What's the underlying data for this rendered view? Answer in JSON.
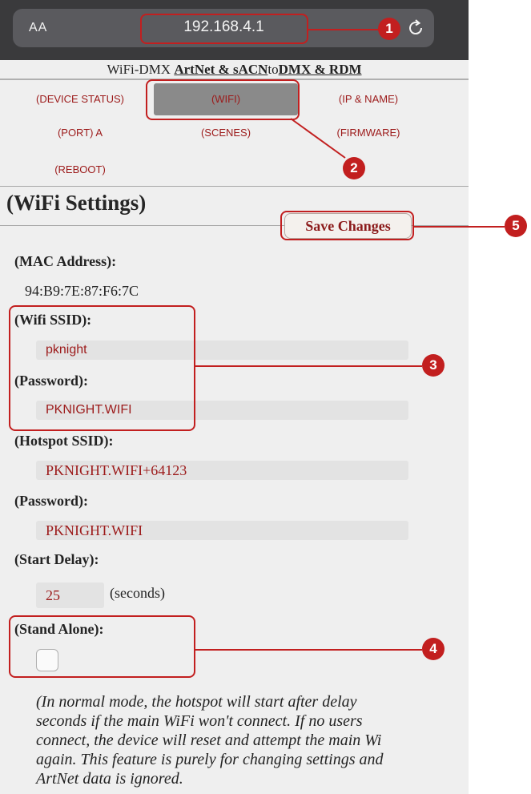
{
  "browser": {
    "text_size_label": "AA",
    "url": "192.168.4.1",
    "reload_icon": "reload-icon"
  },
  "header": {
    "prefix": "WiFi-DMX ",
    "artnet": "ArtNet & sACN",
    "to": "to",
    "dmx": "DMX & RDM"
  },
  "nav": {
    "device_status": "(DEVICE STATUS)",
    "wifi": "(WIFI)",
    "ip_name": "(IP & NAME)",
    "port_a": "(PORT) A",
    "scenes": "(SCENES)",
    "firmware": "(FIRMWARE)",
    "reboot": "(REBOOT)"
  },
  "page": {
    "title": "(WiFi Settings)",
    "save_label": "Save Changes"
  },
  "fields": {
    "mac_label": "(MAC Address):",
    "mac_value": "94:B9:7E:87:F6:7C",
    "wifi_ssid_label": "(Wifi SSID):",
    "wifi_ssid_value": "pknight",
    "wifi_password_label": "(Password):",
    "wifi_password_value": "PKNIGHT.WIFI",
    "hotspot_ssid_label": "(Hotspot SSID):",
    "hotspot_ssid_value": "PKNIGHT.WIFI+64123",
    "hotspot_password_label": "(Password):",
    "hotspot_password_value": "PKNIGHT.WIFI",
    "start_delay_label": "(Start Delay):",
    "start_delay_value": "25",
    "start_delay_unit": "(seconds)",
    "stand_alone_label": "(Stand Alone):",
    "stand_alone_checked": false
  },
  "note": {
    "line1": "(In normal mode, the hotspot will start after delay",
    "line2": "seconds if the main WiFi won't connect. If no users",
    "line3": "connect, the device will reset and attempt the main Wi",
    "line4": "again. This feature is purely for changing settings and",
    "line5": "ArtNet data is ignored."
  },
  "annotations": {
    "b1": "1",
    "b2": "2",
    "b3": "3",
    "b4": "4",
    "b5": "5",
    "color": "#c21f1f"
  }
}
